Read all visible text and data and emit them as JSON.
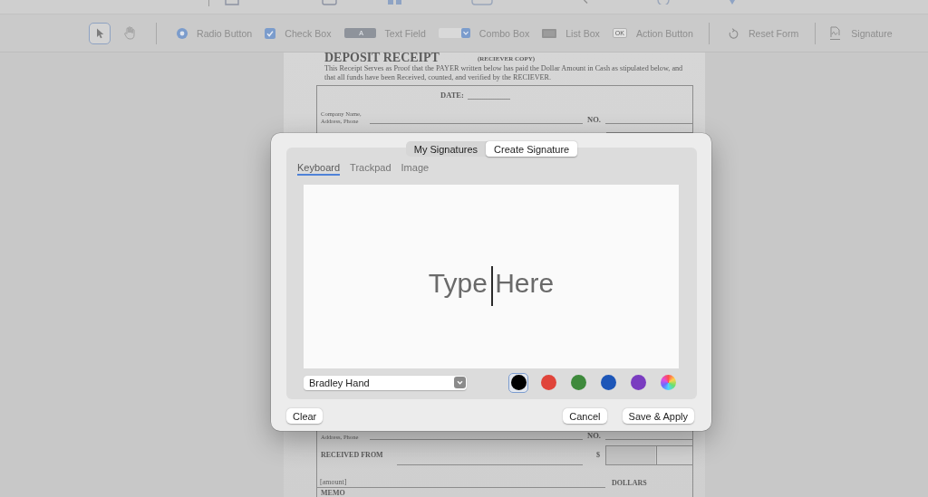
{
  "toolbar": {
    "tools": [
      {
        "kind": "pointer",
        "selected": true
      },
      {
        "kind": "hand",
        "selected": false
      }
    ],
    "form_tools": [
      {
        "kind": "radio",
        "label": "Radio Button"
      },
      {
        "kind": "checkbox",
        "label": "Check Box"
      },
      {
        "kind": "text_field",
        "label": "Text Field",
        "glyph": "A"
      },
      {
        "kind": "combo_box",
        "label": "Combo Box"
      },
      {
        "kind": "list_box",
        "label": "List Box"
      },
      {
        "kind": "action_button",
        "label": "Action Button",
        "glyph": "OK"
      }
    ],
    "actions": [
      {
        "kind": "reset",
        "label": "Reset Form"
      },
      {
        "kind": "signature",
        "label": "Signature"
      }
    ]
  },
  "document": {
    "title": "DEPOSIT RECEIPT",
    "subtitle": "(RECIEVER COPY)",
    "intro": "This Receipt Serves as Proof that the PAYER written below has paid the Dollar Amount in Cash as stipulated below, and that all funds have been Received, counted, and verified by the RECIEVER.",
    "date_label": "DATE:",
    "company_label": "Company Name, Address, Phone",
    "number_label": "NO.",
    "lower_company_label": "Address, Phone",
    "lower_number_label": "NO.",
    "received_from_label": "RECEIVED FROM",
    "currency_sign": "$",
    "amount_placeholder": "[amount]",
    "dollars_label": "DOLLARS",
    "memo_label": "MEMO"
  },
  "signature_dialog": {
    "segments": [
      {
        "label": "My Signatures",
        "selected": false
      },
      {
        "label": "Create Signature",
        "selected": true
      }
    ],
    "tabs": [
      {
        "label": "Keyboard",
        "selected": true
      },
      {
        "label": "Trackpad",
        "selected": false
      },
      {
        "label": "Image",
        "selected": false
      }
    ],
    "input": {
      "placeholder": "Type Here",
      "focused": true
    },
    "font": {
      "value": "Bradley Hand"
    },
    "colors": [
      {
        "kind": "solid",
        "color": "#000000",
        "selected": true
      },
      {
        "kind": "solid",
        "color": "#e0443a",
        "selected": false
      },
      {
        "kind": "solid",
        "color": "#3e8a3c",
        "selected": false
      },
      {
        "kind": "solid",
        "color": "#1d56b8",
        "selected": false
      },
      {
        "kind": "solid",
        "color": "#7a3cc0",
        "selected": false
      },
      {
        "kind": "wheel",
        "selected": false
      }
    ],
    "buttons": [
      "Clear",
      "Cancel",
      "Save & Apply"
    ]
  }
}
